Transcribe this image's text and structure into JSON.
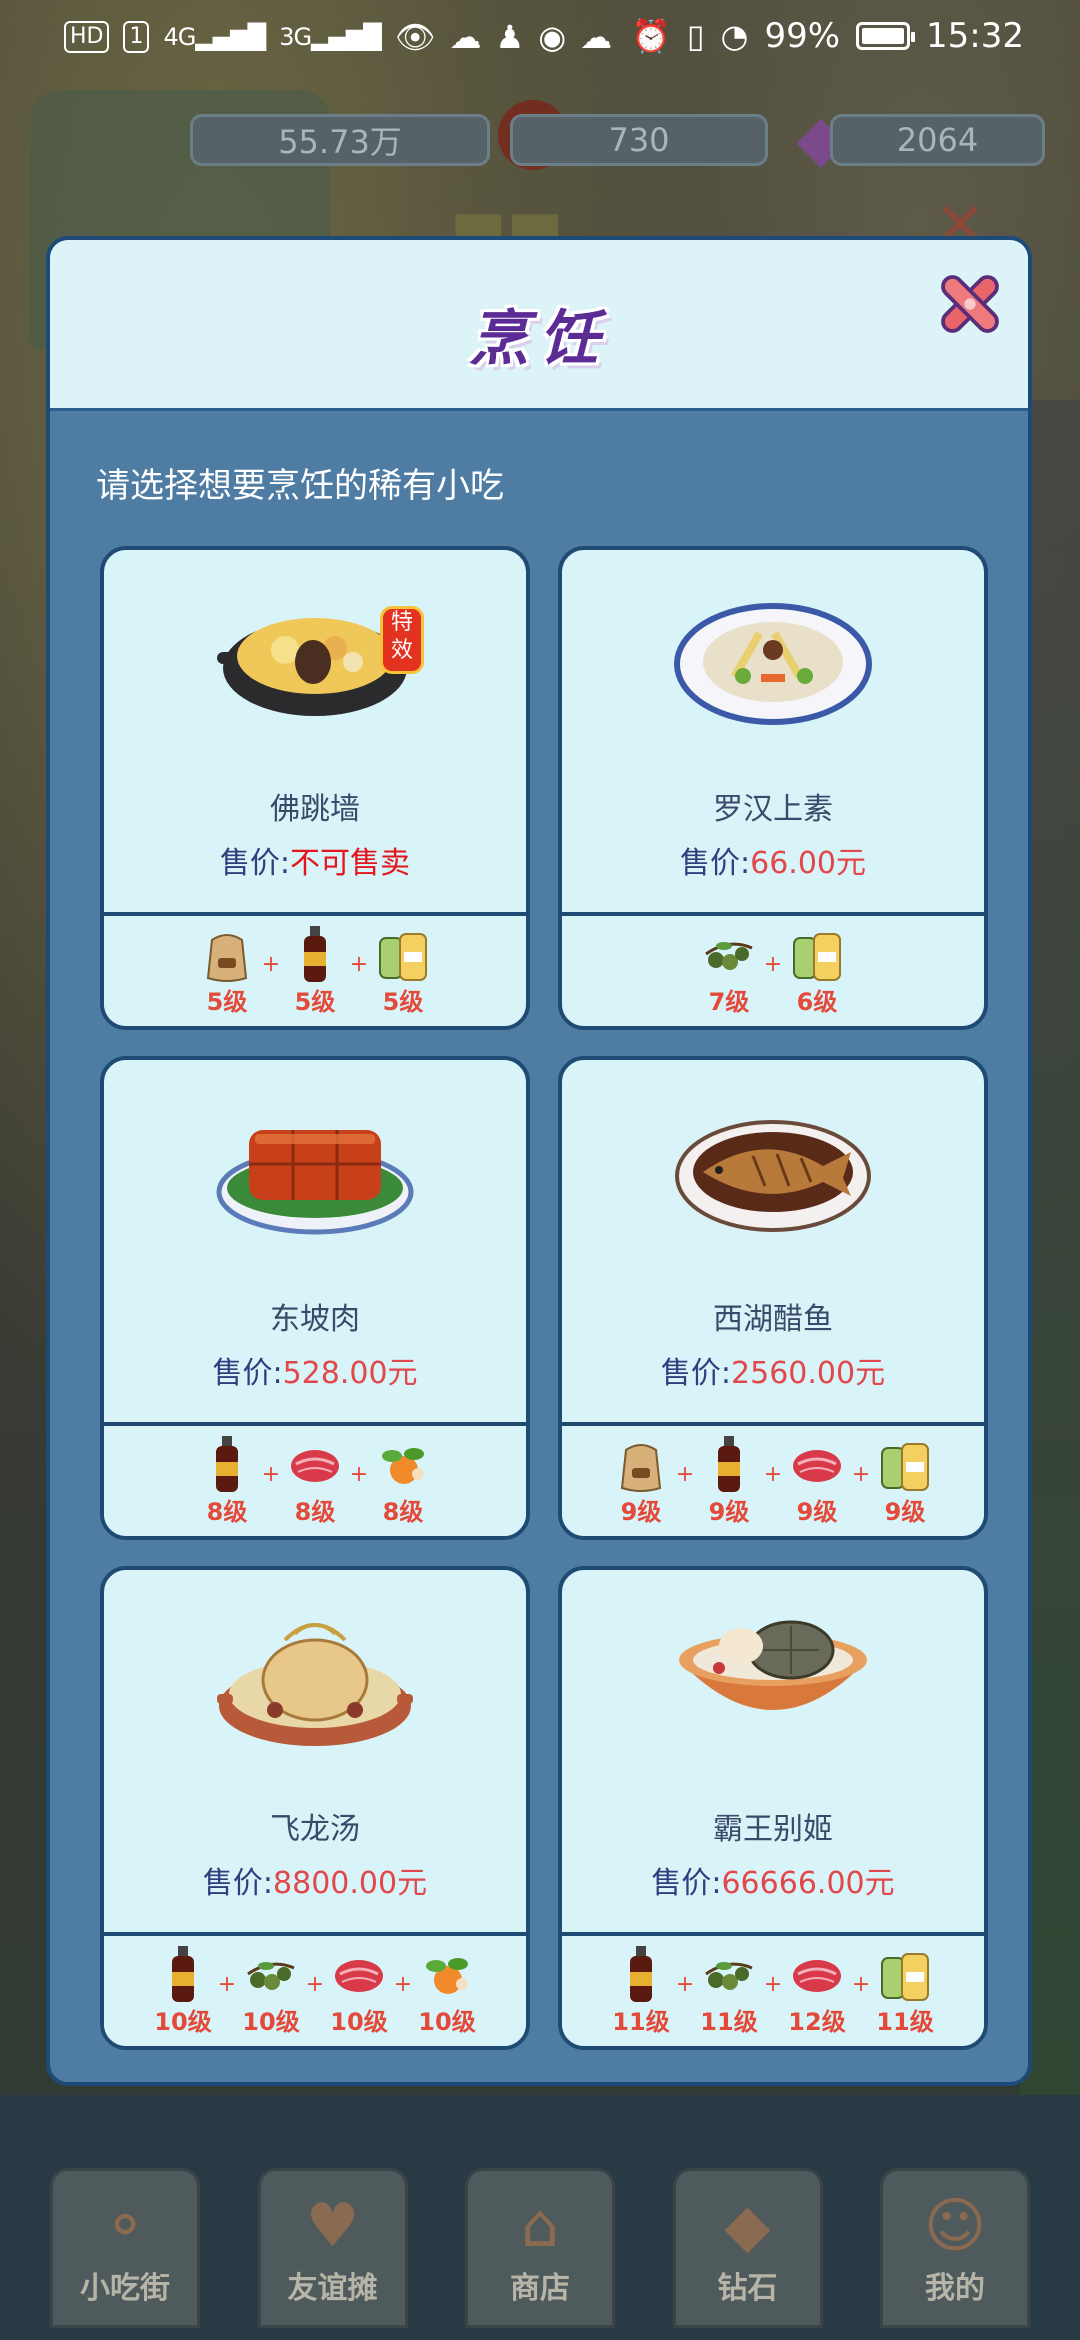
{
  "status_bar": {
    "hd": "HD",
    "sim": "1",
    "net1": "4G",
    "net2": "3G",
    "battery_pct": "99%",
    "time": "15:32"
  },
  "currency": {
    "coins": "55.73万",
    "lanterns": "730",
    "gems": "2064"
  },
  "dialog": {
    "title": "烹饪",
    "prompt": "请选择想要烹饪的稀有小吃",
    "price_label": "售价:"
  },
  "dishes": [
    {
      "name": "佛跳墙",
      "price": "不可售卖",
      "badge": "特效",
      "ingredients": [
        {
          "icon": "flour-sack-icon",
          "level": "5级"
        },
        {
          "icon": "soy-sauce-bottle-icon",
          "level": "5级"
        },
        {
          "icon": "salt-pepper-icon",
          "level": "5级"
        }
      ]
    },
    {
      "name": "罗汉上素",
      "price": "66.00元",
      "ingredients": [
        {
          "icon": "green-pepper-icon",
          "level": "7级"
        },
        {
          "icon": "salt-pepper-icon",
          "level": "6级"
        }
      ]
    },
    {
      "name": "东坡肉",
      "price": "528.00元",
      "ingredients": [
        {
          "icon": "soy-sauce-bottle-icon",
          "level": "8级"
        },
        {
          "icon": "meat-icon",
          "level": "8级"
        },
        {
          "icon": "vegetables-icon",
          "level": "8级"
        }
      ]
    },
    {
      "name": "西湖醋鱼",
      "price": "2560.00元",
      "ingredients": [
        {
          "icon": "flour-sack-icon",
          "level": "9级"
        },
        {
          "icon": "soy-sauce-bottle-icon",
          "level": "9级"
        },
        {
          "icon": "meat-icon",
          "level": "9级"
        },
        {
          "icon": "salt-pepper-icon",
          "level": "9级"
        }
      ]
    },
    {
      "name": "飞龙汤",
      "price": "8800.00元",
      "ingredients": [
        {
          "icon": "soy-sauce-bottle-icon",
          "level": "10级"
        },
        {
          "icon": "green-pepper-icon",
          "level": "10级"
        },
        {
          "icon": "meat-icon",
          "level": "10级"
        },
        {
          "icon": "vegetables-icon",
          "level": "10级"
        }
      ]
    },
    {
      "name": "霸王别姬",
      "price": "66666.00元",
      "ingredients": [
        {
          "icon": "soy-sauce-bottle-icon",
          "level": "11级"
        },
        {
          "icon": "green-pepper-icon",
          "level": "11级"
        },
        {
          "icon": "meat-icon",
          "level": "12级"
        },
        {
          "icon": "salt-pepper-icon",
          "level": "11级"
        }
      ]
    }
  ],
  "bottom_nav": [
    {
      "label": "小吃街",
      "icon": "skewer-icon"
    },
    {
      "label": "友谊摊",
      "icon": "heart-stall-icon"
    },
    {
      "label": "商店",
      "icon": "store-icon"
    },
    {
      "label": "钻石",
      "icon": "diamond-icon"
    },
    {
      "label": "我的",
      "icon": "profile-icon"
    }
  ],
  "colors": {
    "panel": "#4f7ca3",
    "card": "#d8f4f8",
    "price_value": "#e2474b",
    "title": "#5b2d94"
  }
}
